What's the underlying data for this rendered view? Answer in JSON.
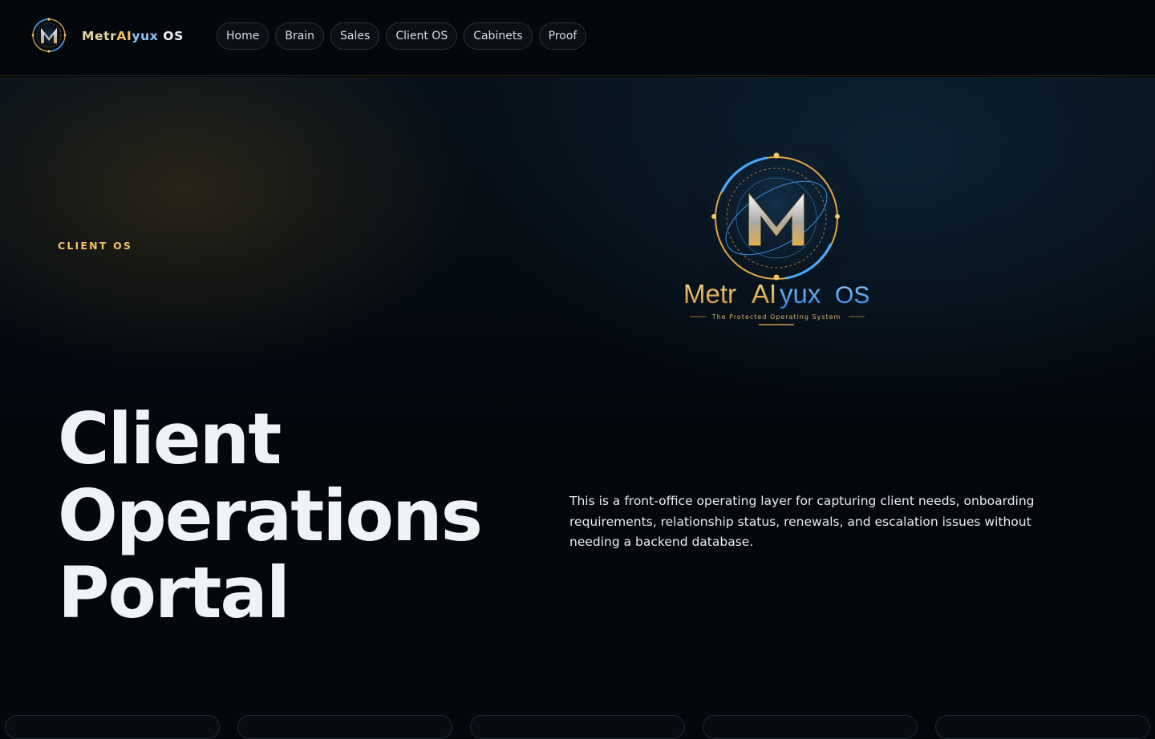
{
  "brand": {
    "name_metr": "Metr",
    "name_ai": "AI",
    "name_yux": "yux",
    "name_os": " OS",
    "logo_icon": "metralyux-m-orbit-icon"
  },
  "nav": {
    "items": [
      {
        "label": "Home"
      },
      {
        "label": "Brain"
      },
      {
        "label": "Sales"
      },
      {
        "label": "Client OS"
      },
      {
        "label": "Cabinets"
      },
      {
        "label": "Proof"
      }
    ]
  },
  "hero": {
    "eyebrow": "CLIENT OS",
    "title_lines": [
      "Client",
      "Operations",
      "Portal"
    ],
    "description": "This is a front-office operating layer for capturing client needs, onboarding requirements, relationship status, renewals, and escalation issues without needing a backend database.",
    "logo": {
      "wordmark_metr": "Metr",
      "wordmark_ai": "AI",
      "wordmark_yux": "yux",
      "wordmark_os": "OS",
      "tagline": "The Protected Operating System"
    }
  },
  "colors": {
    "accent_gold": "#f3c166",
    "accent_blue": "#3aa0ff",
    "background": "#04080d",
    "nav_border": "#2b3038"
  }
}
